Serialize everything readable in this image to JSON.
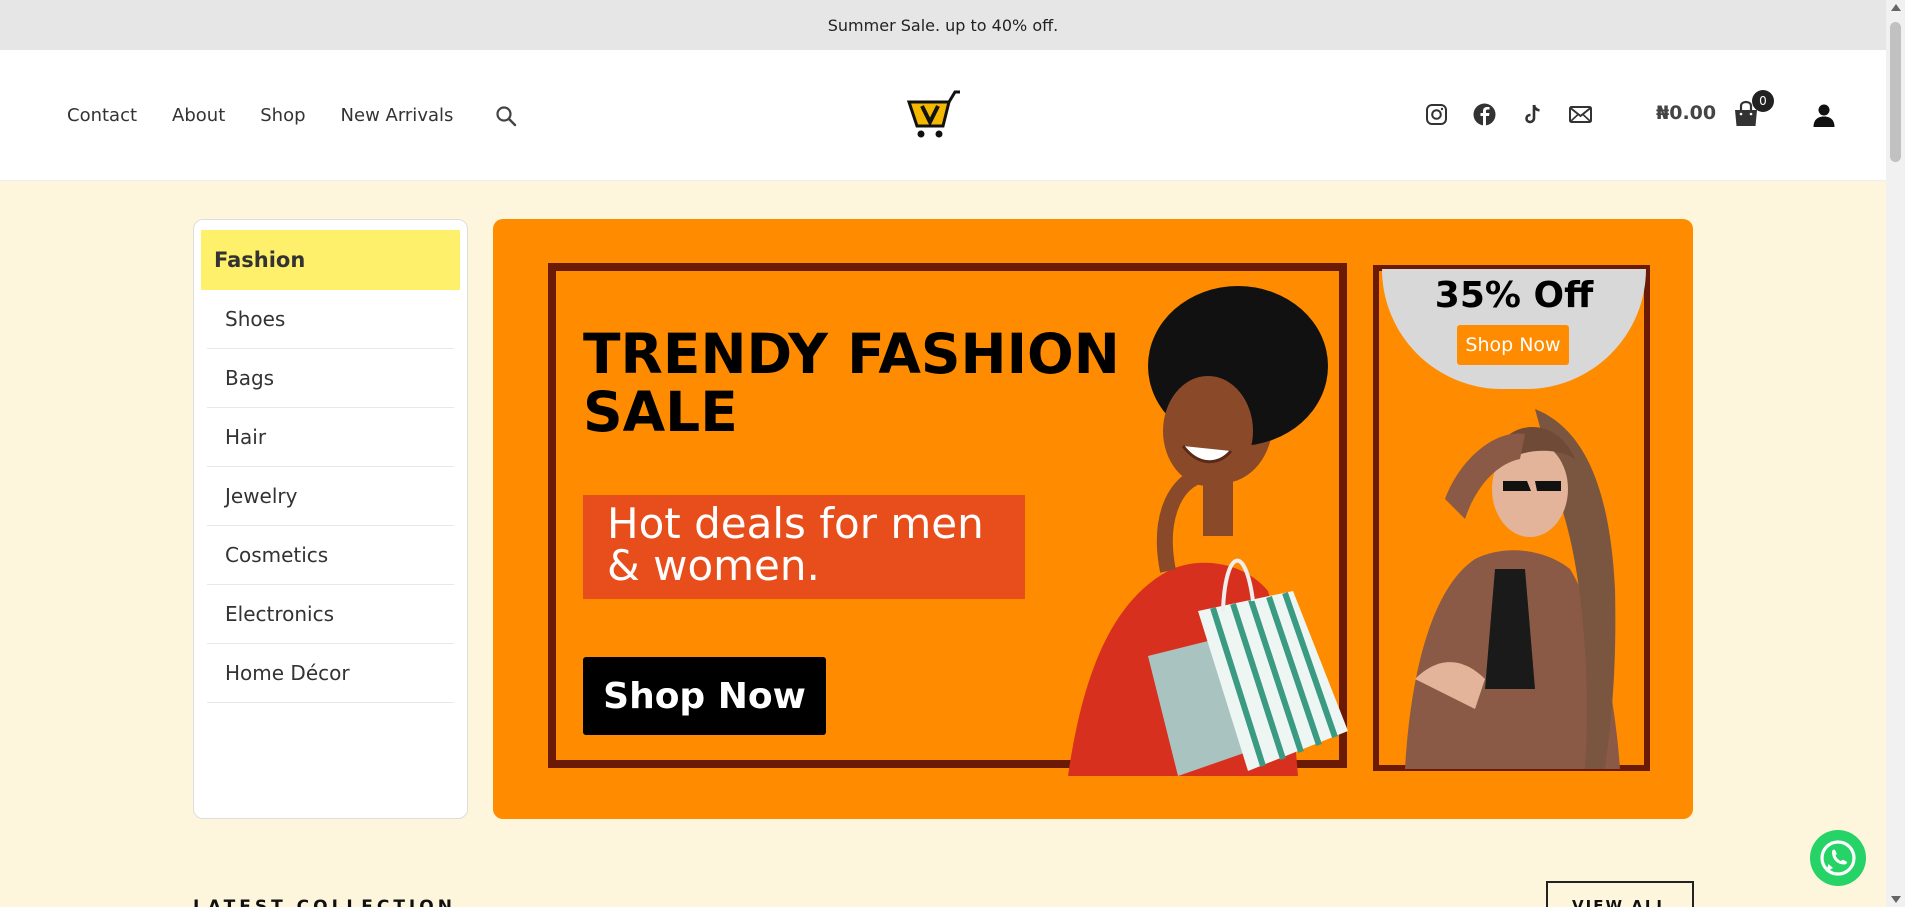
{
  "announcement": "Summer Sale. up to 40% off.",
  "nav": [
    "Contact",
    "About",
    "Shop",
    "New Arrivals"
  ],
  "header": {
    "cart_total": "₦0.00",
    "cart_count": "0",
    "social_icons": [
      "instagram-icon",
      "facebook-icon",
      "tiktok-icon",
      "mail-icon"
    ]
  },
  "categories": {
    "active": "Fashion",
    "items": [
      "Shoes",
      "Bags",
      "Hair",
      "Jewelry",
      "Cosmetics",
      "Electronics",
      "Home Décor"
    ]
  },
  "banner": {
    "headline_line1": "TRENDY FASHION",
    "headline_line2": "SALE",
    "deal_text": "Hot deals for men & women.",
    "shop_now": "Shop Now",
    "side_offer": "35% Off",
    "side_shop_now": "Shop Now"
  },
  "section": {
    "title": "LATEST COLLECTION",
    "view_all": "VIEW ALL"
  },
  "colors": {
    "accent": "#ff8c00",
    "active_category": "#fff06c",
    "deal_box": "#e84e1b",
    "background": "#fdf6dc"
  }
}
